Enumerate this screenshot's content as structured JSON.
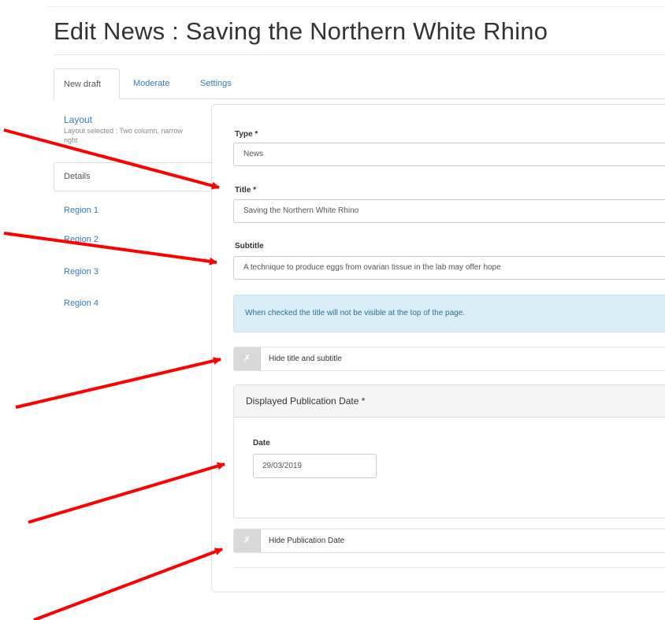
{
  "page_title": "Edit News : Saving the Northern White Rhino",
  "tabs": [
    {
      "label": "New draft",
      "active": true
    },
    {
      "label": "Moderate",
      "active": false
    },
    {
      "label": "Settings",
      "active": false
    }
  ],
  "sidebar": {
    "layout_link": "Layout",
    "layout_desc": "Layout selected : Two column, narrow right",
    "items": [
      {
        "label": "Details",
        "active": true
      },
      {
        "label": "Region 1"
      },
      {
        "label": "Region 2"
      },
      {
        "label": "Region 3"
      },
      {
        "label": "Region 4"
      }
    ]
  },
  "form": {
    "type_label": "Type *",
    "type_value": "News",
    "title_label": "Title *",
    "title_value": "Saving the Northern White Rhino",
    "subtitle_label": "Subtitle",
    "subtitle_value": "A technique to produce eggs from ovarian tissue in the lab may offer hope",
    "info_text": "When checked the title will not be visible at the top of the page.",
    "hide_title_label": "Hide title and subtitle",
    "hide_title_checked": false,
    "toggle_glyph": "✗",
    "pub_date_header": "Displayed Publication Date *",
    "date_label": "Date",
    "date_value": "29/03/2019",
    "hide_pub_date_label": "Hide Publication Date",
    "hide_pub_date_checked": false
  },
  "colors": {
    "link": "#337ab7",
    "info_bg": "#d9edf7",
    "info_text": "#31708f",
    "arrow": "#ff0000"
  }
}
